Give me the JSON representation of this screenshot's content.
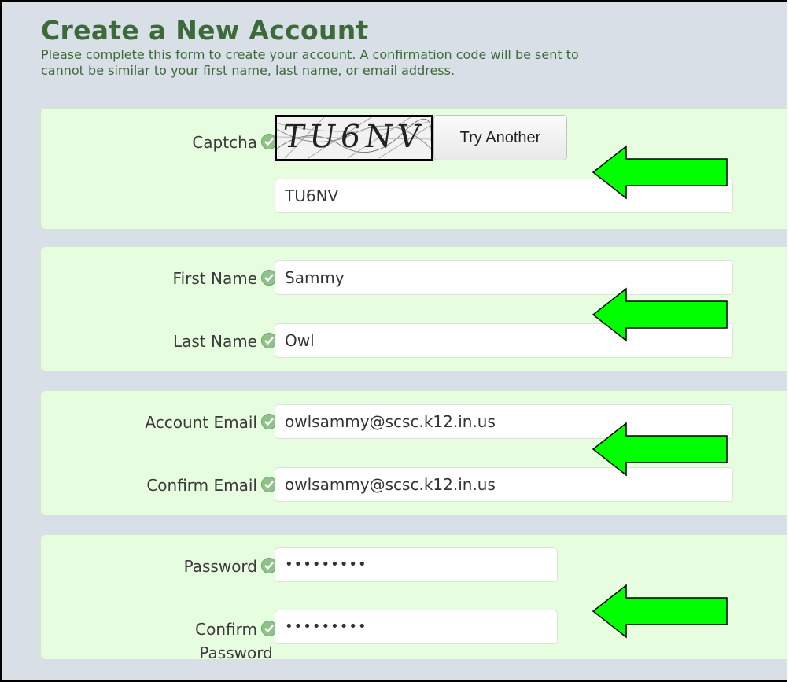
{
  "header": {
    "title": "Create a New Account",
    "description_line1": "Please complete this form to create your account. A confirmation code will be sent to",
    "description_line2": "cannot be similar to your first name, last name, or email address."
  },
  "captcha": {
    "label": "Captcha",
    "image_text": "TU6NV",
    "button_label": "Try Another",
    "value": "TU6NV"
  },
  "name": {
    "first_label": "First Name",
    "first_value": "Sammy",
    "last_label": "Last Name",
    "last_value": "Owl"
  },
  "email": {
    "account_label": "Account Email",
    "account_value": "owlsammy@scsc.k12.in.us",
    "confirm_label": "Confirm Email",
    "confirm_value": "owlsammy@scsc.k12.in.us"
  },
  "password": {
    "password_label": "Password",
    "password_value": "•••••••••",
    "confirm_label_line1": "Confirm",
    "confirm_label_line2": "Password",
    "confirm_value": "•••••••••"
  },
  "colors": {
    "panel_bg": "#e6fde0",
    "page_bg": "#d8dfe6",
    "title": "#3d6a3a",
    "arrow": "#00ff00"
  },
  "icons": {
    "valid": "check-circle-icon",
    "annotation": "left-arrow-icon"
  }
}
